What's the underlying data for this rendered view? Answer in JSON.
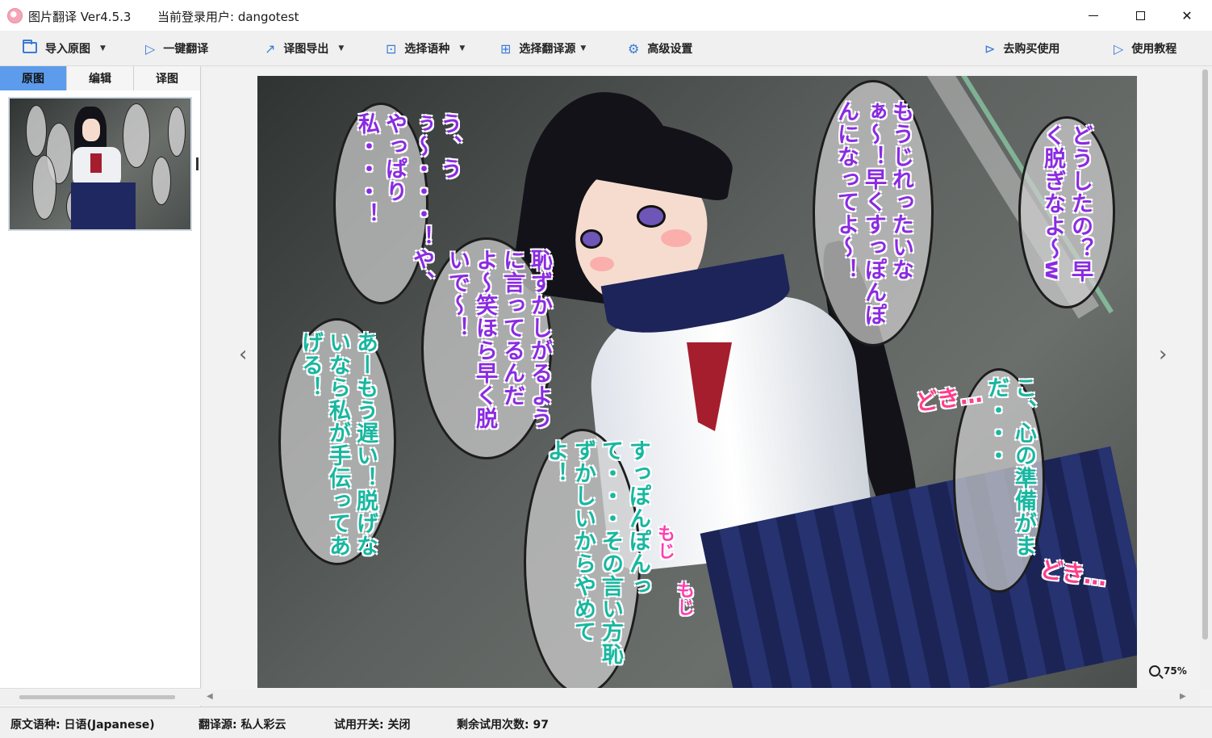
{
  "window": {
    "title": "图片翻译 Ver4.5.3",
    "login": "当前登录用户: dangotest"
  },
  "toolbar": {
    "import": "导入原图",
    "translate": "一键翻译",
    "export": "译图导出",
    "language": "选择语种",
    "source": "选择翻译源",
    "settings": "高级设置",
    "buy": "去购买使用",
    "tutorial": "使用教程"
  },
  "tabs": [
    "原图",
    "编辑",
    "译图"
  ],
  "viewer": {
    "zoom": "75%"
  },
  "image_text": {
    "b1": [
      "う、うぅ〜・・・！",
      "や、やっぱり私・・・！"
    ],
    "b2": [
      "あーもう遅い！",
      "脱げないなら",
      "私が手伝ってあげる！"
    ],
    "b3": [
      "恥ずかしがるように",
      "言ってるんだよ〜笑",
      "ほら早く脱いで〜！"
    ],
    "b4": [
      "もうじれったいなぁ〜！",
      "早くすっぽんぽんに",
      "なってよ〜！"
    ],
    "b5": [
      "どうしたの？",
      "早く脱ぎなよ〜w"
    ],
    "b6": [
      "すっぽんぽんって・・・",
      "その言い方恥ずかしいから",
      "やめてよ！"
    ],
    "b7": [
      "こ、心の準備がまだ・・・"
    ],
    "sfx1": "どき…",
    "sfx2": "どき…",
    "sfx3": "もじ",
    "sfx4": "もじ"
  },
  "status": {
    "source_lang": "原文语种: 日语(Japanese)",
    "engine": "翻译源: 私人彩云",
    "trial": "试用开关: 关闭",
    "remaining": "剩余试用次数: 97"
  }
}
